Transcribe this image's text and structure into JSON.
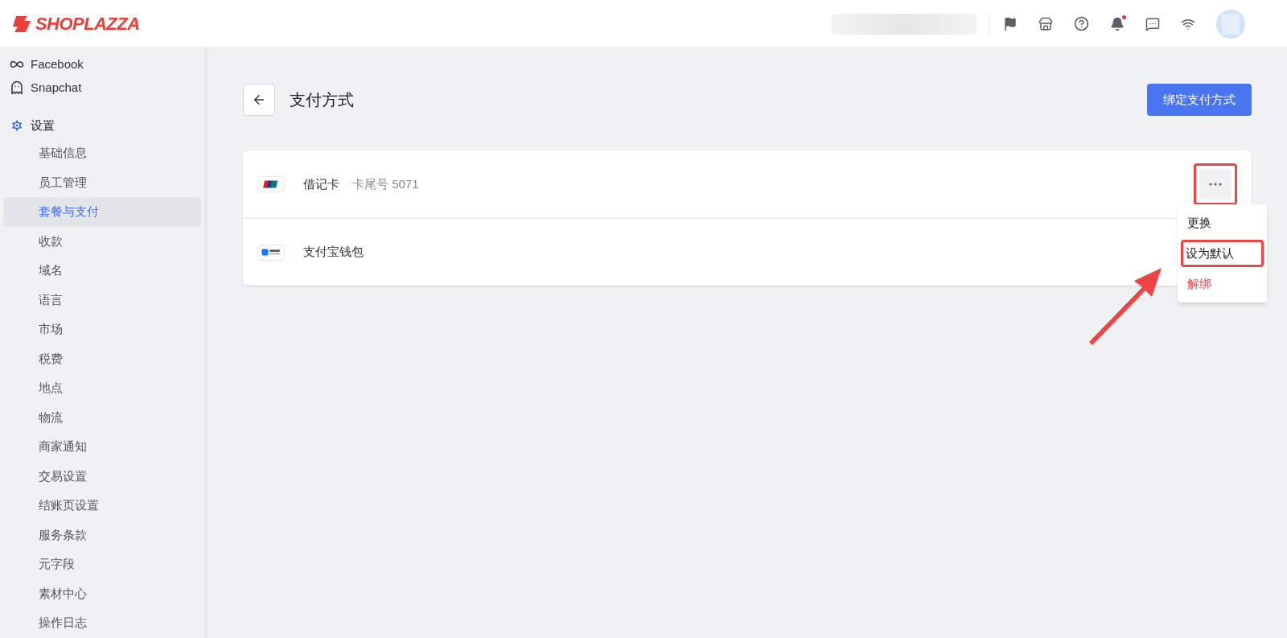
{
  "header": {
    "logo": "SHOPLAZZA",
    "notification_dot": true
  },
  "sidebar": {
    "channels": [
      {
        "label": "Facebook",
        "kind": "facebook"
      },
      {
        "label": "Snapchat",
        "kind": "snapchat"
      }
    ],
    "section": {
      "label": "设置",
      "items": [
        {
          "label": "基础信息",
          "selected": false
        },
        {
          "label": "员工管理",
          "selected": false
        },
        {
          "label": "套餐与支付",
          "selected": true
        },
        {
          "label": "收款",
          "selected": false
        },
        {
          "label": "域名",
          "selected": false
        },
        {
          "label": "语言",
          "selected": false
        },
        {
          "label": "市场",
          "selected": false
        },
        {
          "label": "税费",
          "selected": false
        },
        {
          "label": "地点",
          "selected": false
        },
        {
          "label": "物流",
          "selected": false
        },
        {
          "label": "商家通知",
          "selected": false
        },
        {
          "label": "交易设置",
          "selected": false
        },
        {
          "label": "结账页设置",
          "selected": false
        },
        {
          "label": "服务条款",
          "selected": false
        },
        {
          "label": "元字段",
          "selected": false
        },
        {
          "label": "素材中心",
          "selected": false
        },
        {
          "label": "操作日志",
          "selected": false
        }
      ]
    }
  },
  "page": {
    "title": "支付方式",
    "primary_button": "绑定支付方式"
  },
  "methods": [
    {
      "kind": "unionpay",
      "name": "借记卡",
      "detail": "卡尾号 5071",
      "menu_button": {
        "highlighted": true
      }
    },
    {
      "kind": "alipay",
      "name": "支付宝钱包"
    }
  ],
  "menu": [
    {
      "label": "更换",
      "kind": "normal",
      "highlighted": false
    },
    {
      "label": "设为默认",
      "kind": "normal",
      "highlighted": true
    },
    {
      "label": "解绑",
      "kind": "danger",
      "highlighted": false
    }
  ]
}
